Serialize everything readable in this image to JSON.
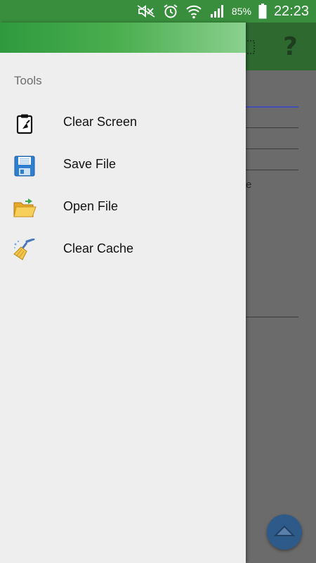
{
  "status_bar": {
    "battery_percent": "85%",
    "time": "22:23",
    "icons": [
      "mute-icon",
      "alarm-icon",
      "wifi-icon",
      "signal-icon",
      "battery-icon"
    ]
  },
  "app": {
    "toolbar_icons": [
      "grid-icon",
      "help-icon"
    ],
    "help_glyph": "?",
    "partial_text": "e"
  },
  "drawer": {
    "section_title": "Tools",
    "items": [
      {
        "label": "Clear Screen",
        "icon": "clipboard-icon"
      },
      {
        "label": "Save File",
        "icon": "floppy-disk-icon"
      },
      {
        "label": "Open File",
        "icon": "open-folder-icon"
      },
      {
        "label": "Clear Cache",
        "icon": "broom-icon"
      }
    ]
  },
  "colors": {
    "status_bar": "#388e3c",
    "drawer_header": "#4caf50",
    "drawer_background": "#eeeeee",
    "fab": "#2e5a8a"
  }
}
